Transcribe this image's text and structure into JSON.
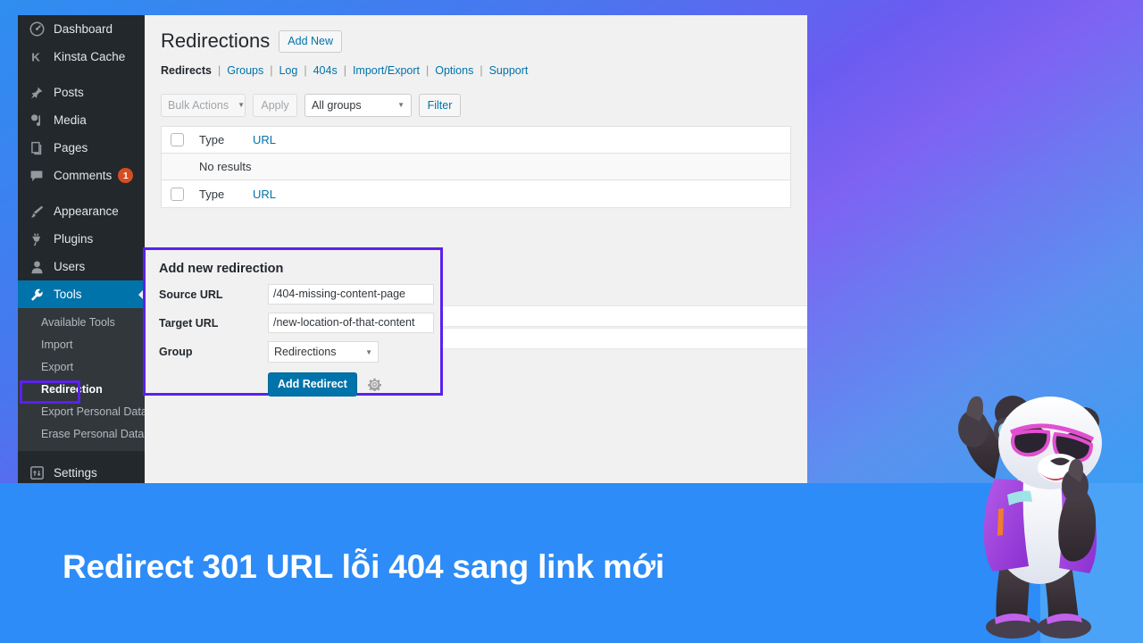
{
  "banner": {
    "caption": "Redirect 301 URL lỗi 404 sang link mới",
    "bg_color": "#2d8cf7",
    "wedge_color": "#4aa3f7",
    "text_color": "#ffffff"
  },
  "colors": {
    "wp_sidebar_bg": "#23282d",
    "wp_submenu_bg": "#32373c",
    "wp_active_blue": "#0073aa",
    "highlight_purple": "#5b21ec",
    "badge_orange": "#d54e21",
    "link_blue": "#0073aa",
    "panel_bg": "#f1f1f1"
  },
  "sidebar": {
    "items": [
      {
        "label": "Dashboard",
        "icon": "dashboard-icon",
        "active": false
      },
      {
        "label": "Kinsta Cache",
        "icon": "kinsta-icon",
        "active": false
      },
      {
        "label": "Posts",
        "icon": "pin-icon",
        "active": false
      },
      {
        "label": "Media",
        "icon": "media-icon",
        "active": false
      },
      {
        "label": "Pages",
        "icon": "pages-icon",
        "active": false
      },
      {
        "label": "Comments",
        "icon": "comments-icon",
        "active": false,
        "badge": "1"
      },
      {
        "label": "Appearance",
        "icon": "brush-icon",
        "active": false
      },
      {
        "label": "Plugins",
        "icon": "plug-icon",
        "active": false
      },
      {
        "label": "Users",
        "icon": "user-icon",
        "active": false
      },
      {
        "label": "Tools",
        "icon": "wrench-icon",
        "active": true
      },
      {
        "label": "Settings",
        "icon": "settings-icon",
        "active": false
      }
    ],
    "tools_submenu": [
      {
        "label": "Available Tools",
        "current": false
      },
      {
        "label": "Import",
        "current": false
      },
      {
        "label": "Export",
        "current": false
      },
      {
        "label": "Redirection",
        "current": true
      },
      {
        "label": "Export Personal Data",
        "current": false
      },
      {
        "label": "Erase Personal Data",
        "current": false
      }
    ]
  },
  "page": {
    "title": "Redirections",
    "add_new_label": "Add New",
    "subnav": [
      {
        "label": "Redirects",
        "current": true
      },
      {
        "label": "Groups",
        "current": false
      },
      {
        "label": "Log",
        "current": false
      },
      {
        "label": "404s",
        "current": false
      },
      {
        "label": "Import/Export",
        "current": false
      },
      {
        "label": "Options",
        "current": false
      },
      {
        "label": "Support",
        "current": false
      }
    ],
    "separator": "|"
  },
  "toolbar": {
    "bulk_actions_label": "Bulk Actions",
    "apply_label": "Apply",
    "groups_filter_value": "All groups",
    "filter_label": "Filter",
    "caret": "▼"
  },
  "table": {
    "columns": {
      "type": "Type",
      "url": "URL"
    },
    "empty_message": "No results"
  },
  "add_form": {
    "title": "Add new redirection",
    "fields": [
      {
        "label": "Source URL",
        "value": "/404-missing-content-page",
        "name": "source-url-field"
      },
      {
        "label": "Target URL",
        "value": "/new-location-of-that-content",
        "name": "target-url-field"
      }
    ],
    "group_label": "Group",
    "group_value": "Redirections",
    "submit_label": "Add Redirect",
    "gear_icon": "gear-icon",
    "caret": "▼"
  }
}
